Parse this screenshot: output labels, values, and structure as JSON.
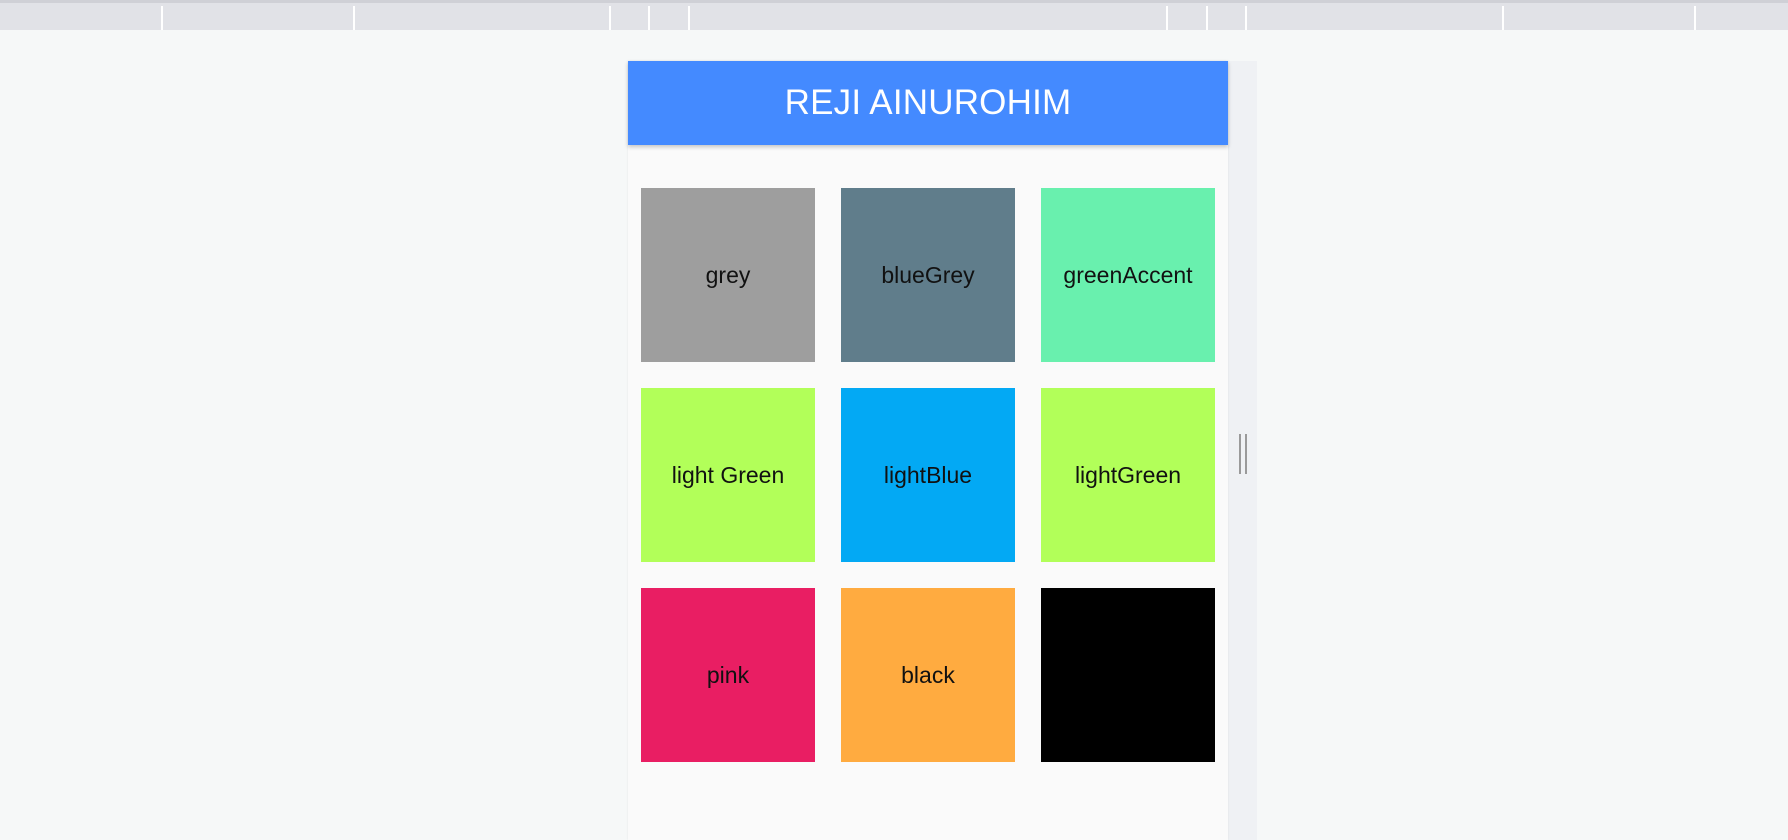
{
  "app": {
    "title": "REJI AINUROHIM",
    "appbar_color": "#448aff"
  },
  "tiles": [
    {
      "label": "grey",
      "color": "#9e9e9e"
    },
    {
      "label": "blueGrey",
      "color": "#607d8b"
    },
    {
      "label": "greenAccent",
      "color": "#69f0ae"
    },
    {
      "label": "light Green",
      "color": "#b2ff59"
    },
    {
      "label": "lightBlue",
      "color": "#03a9f4"
    },
    {
      "label": "lightGreen",
      "color": "#b2ff59"
    },
    {
      "label": "pink",
      "color": "#e91e63"
    },
    {
      "label": "black",
      "color": "#ffab40"
    },
    {
      "label": "",
      "color": "#000000"
    }
  ]
}
